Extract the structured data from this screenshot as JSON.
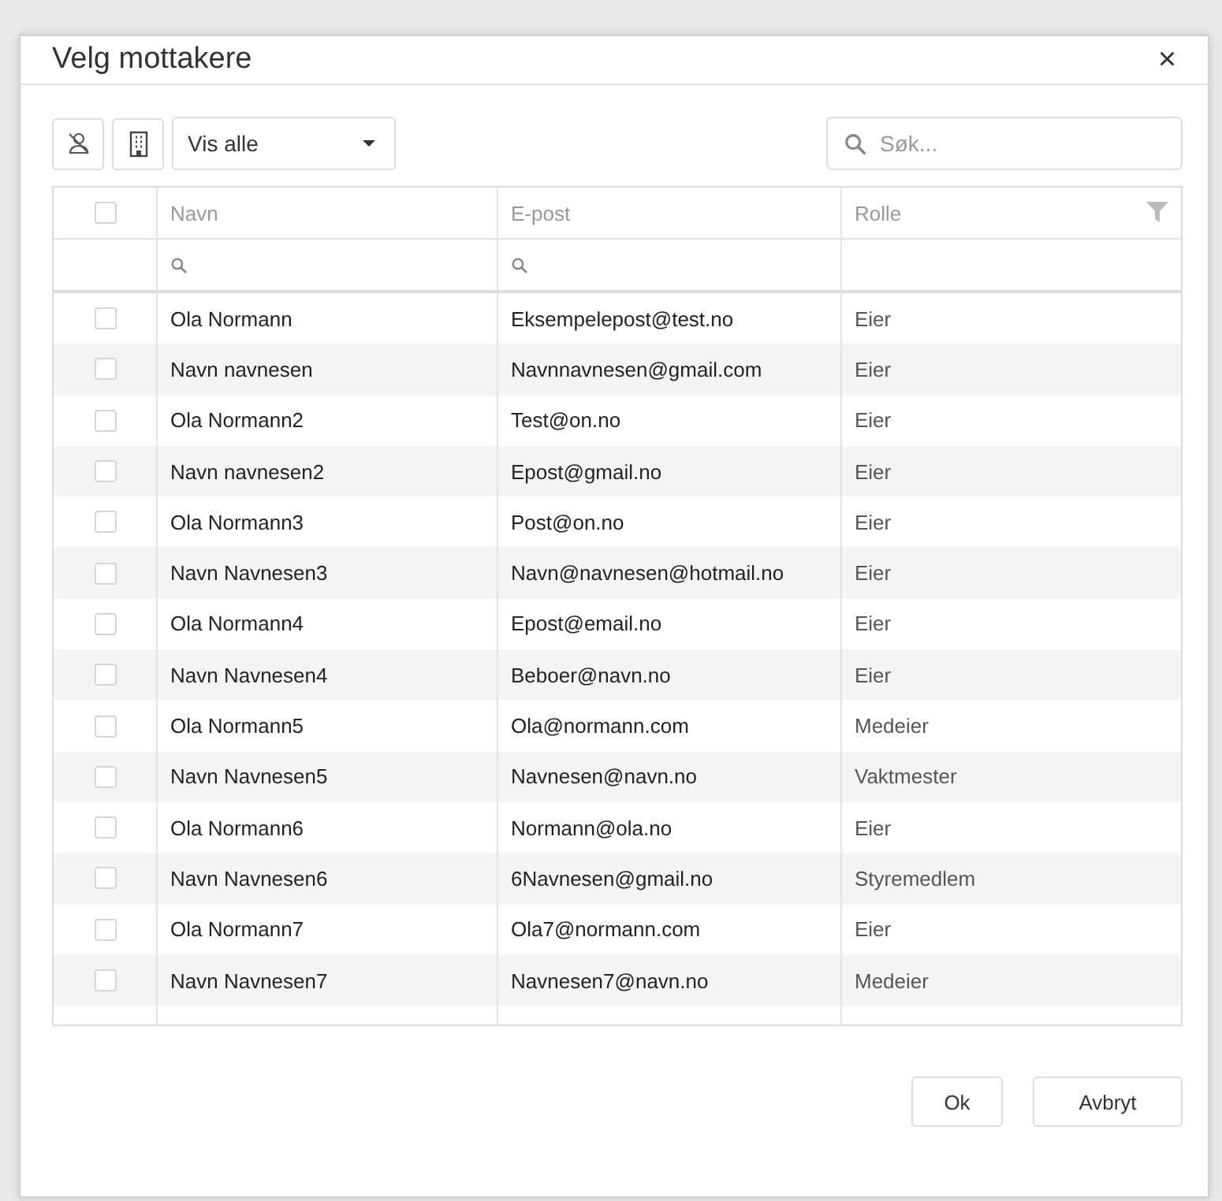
{
  "dialog": {
    "title": "Velg mottakere",
    "close": "×"
  },
  "toolbar": {
    "filter": "Vis alle",
    "search": {
      "placeholder": "Søk..."
    }
  },
  "table": {
    "all_selected": false,
    "columns": [
      "Navn",
      "E-post",
      "Rolle"
    ],
    "rows": [
      {
        "selected": false,
        "name": "Ola Normann",
        "email": "Eksempelepost@test.no",
        "role": "Eier"
      },
      {
        "selected": false,
        "name": "Navn navnesen",
        "email": "Navnnavnesen@gmail.com",
        "role": "Eier"
      },
      {
        "selected": false,
        "name": "Ola Normann2",
        "email": "Test@on.no",
        "role": "Eier"
      },
      {
        "selected": false,
        "name": "Navn navnesen2",
        "email": "Epost@gmail.no",
        "role": "Eier"
      },
      {
        "selected": false,
        "name": "Ola Normann3",
        "email": "Post@on.no",
        "role": "Eier"
      },
      {
        "selected": false,
        "name": "Navn Navnesen3",
        "email": "Navn@navnesen@hotmail.no",
        "role": "Eier"
      },
      {
        "selected": false,
        "name": "Ola Normann4",
        "email": "Epost@email.no",
        "role": "Eier"
      },
      {
        "selected": false,
        "name": "Navn Navnesen4",
        "email": "Beboer@navn.no",
        "role": "Eier"
      },
      {
        "selected": false,
        "name": "Ola Normann5",
        "email": "Ola@normann.com",
        "role": "Medeier"
      },
      {
        "selected": false,
        "name": "Navn Navnesen5",
        "email": "Navnesen@navn.no",
        "role": "Vaktmester"
      },
      {
        "selected": false,
        "name": "Ola Normann6",
        "email": "Normann@ola.no",
        "role": "Eier"
      },
      {
        "selected": false,
        "name": "Navn Navnesen6",
        "email": "6Navnesen@gmail.no",
        "role": "Styremedlem"
      },
      {
        "selected": false,
        "name": "Ola Normann7",
        "email": "Ola7@normann.com",
        "role": "Eier"
      },
      {
        "selected": false,
        "name": "Navn Navnesen7",
        "email": "Navnesen7@navn.no",
        "role": "Medeier"
      }
    ]
  },
  "buttons": [
    "Ok",
    "Avbryt"
  ]
}
